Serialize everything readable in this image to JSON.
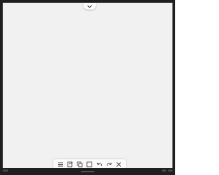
{
  "colors": {
    "bezel": "#1f1f1f",
    "canvas": "#f1f1f1",
    "toolbar": "#fafafa",
    "icon": "#333333"
  },
  "top_tab": {
    "icon": "chevron-down-icon"
  },
  "toolbar": {
    "tools": [
      {
        "name": "menu",
        "icon": "menu-icon"
      },
      {
        "name": "notes",
        "icon": "notes-icon"
      },
      {
        "name": "copy",
        "icon": "copy-icon"
      },
      {
        "name": "select",
        "icon": "square-select-icon"
      },
      {
        "name": "undo",
        "icon": "undo-icon"
      },
      {
        "name": "redo",
        "icon": "redo-icon"
      },
      {
        "name": "close",
        "icon": "close-icon"
      }
    ]
  }
}
